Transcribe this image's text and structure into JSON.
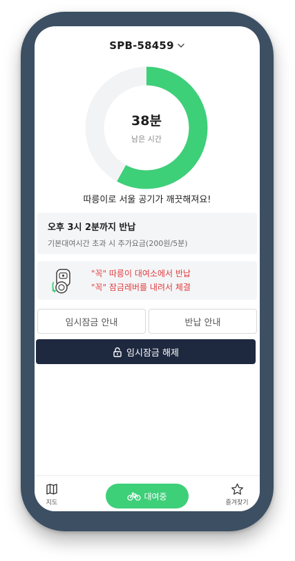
{
  "header": {
    "device_id": "SPB-58459"
  },
  "timer": {
    "remaining_value": "38분",
    "remaining_label": "남은 시간",
    "remaining_fraction": 0.58,
    "progress_color": "#3ecf79",
    "track_color": "#f2f3f5"
  },
  "slogan": "따릉이로 서울 공기가 깨끗해져요!",
  "return_info": {
    "title": "오후 3시 2분까지 반납",
    "subtitle": "기본대여시간 초과 시 추가요금(200원/5분)"
  },
  "warning": {
    "icon": "bike-lock-icon",
    "line1": "\"꼭\" 따릉이 대여소에서 반납",
    "line2": "\"꼭\" 잠금레버를 내려서 체결",
    "color": "#e03c3c"
  },
  "buttons": {
    "temp_lock_guide": "임시잠금 안내",
    "return_guide": "반납 안내",
    "temp_unlock": "임시잠금 해제"
  },
  "bottom_nav": {
    "map_label": "지도",
    "renting_label": "대여중",
    "favorites_label": "즐겨찾기",
    "accent_color": "#3ecf79"
  },
  "frame": {
    "bezel_color": "#3c4f63"
  }
}
